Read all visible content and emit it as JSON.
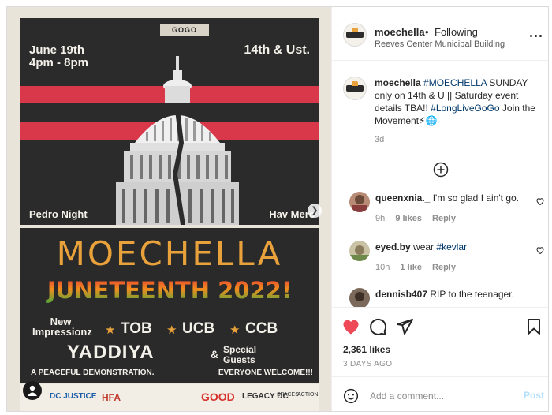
{
  "post": {
    "username": "moechella",
    "separator": "•",
    "follow_status": "Following",
    "location": "Reeves Center Municipal Building"
  },
  "poster": {
    "brand": "GOGO",
    "date": "June 19th",
    "time": "4pm - 8pm",
    "venue": "14th & Ust.",
    "left_label": "Pedro Night",
    "right_label": "Hav Merc",
    "title": "MOECHELLA",
    "subtitle": "JUNETEENTH 2022!",
    "acts": [
      "New Impressionz",
      "TOB",
      "UCB",
      "CCB"
    ],
    "headliner": "YADDIYA",
    "ampersand": "&",
    "special_guests": "Special Guests",
    "bottom_left": "A PEACEFUL DEMONSTRATION.",
    "bottom_right": "EVERYONE WELCOME!!!",
    "sponsors": [
      "DC JUSTICE",
      "HFA",
      "GOOD",
      "LEGACY DC",
      "SPACES",
      "ACTION"
    ],
    "colors": {
      "red": "#e8394d",
      "orange": "#e9a23b",
      "green": "#4ca83a",
      "dark": "#2a2a2a"
    }
  },
  "caption": {
    "username": "moechella",
    "tag1": "#MOECHELLA",
    "text1": " SUNDAY only on 14th & U || Saturday event details TBA!! ",
    "tag2": "#LongLiveGoGo",
    "text2": " Join the Movement",
    "emoji": "⚡🌐",
    "time": "3d"
  },
  "comments": [
    {
      "username": "queenxnia._",
      "text": "I'm so glad I ain't go.",
      "time": "9h",
      "likes": "9 likes",
      "reply": "Reply"
    },
    {
      "username": "eyed.by",
      "text": "wear ",
      "tag": "#kevlar",
      "time": "10h",
      "likes": "1 like",
      "reply": "Reply"
    },
    {
      "username": "dennisb407",
      "text": "RIP to the teenager."
    }
  ],
  "engagement": {
    "likes": "2,361 likes",
    "posted": "3 DAYS AGO",
    "liked": true,
    "like_color": "#ed4956"
  },
  "composer": {
    "placeholder": "Add a comment...",
    "post_label": "Post"
  }
}
